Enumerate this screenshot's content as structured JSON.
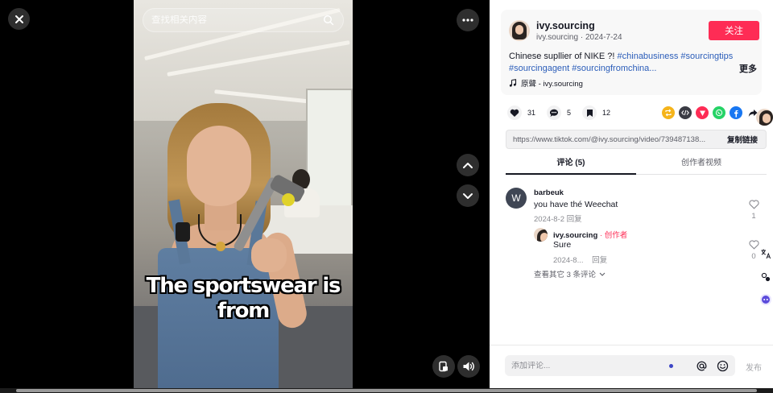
{
  "player": {
    "search": {
      "placeholder": "查找相关内容"
    },
    "caption_lines": [
      "The sportswear is",
      "from"
    ],
    "icons": {
      "close": "close-icon",
      "more": "more-icon",
      "prev": "chevron-up-icon",
      "next": "chevron-down-icon",
      "mini_player": "mini-player-icon",
      "volume": "volume-icon",
      "search": "search-icon"
    }
  },
  "author": {
    "name": "ivy.sourcing",
    "meta": "ivy.sourcing · 2024-7-24",
    "follow_label": "关注",
    "description_text": "Chinese supllier of NIKE ?! ",
    "hashtags": [
      "#chinabusiness",
      "#sourcingtips",
      "#sourcingagent",
      "#sourcingfromchina..."
    ],
    "more_label": "更多",
    "music": "原聲 - ivy.sourcing"
  },
  "actions": [
    {
      "icon": "heart-icon",
      "count": "31"
    },
    {
      "icon": "comment-icon",
      "count": "5"
    },
    {
      "icon": "bookmark-icon",
      "count": "12"
    }
  ],
  "share_icons": [
    "repost-icon",
    "embed-icon",
    "send-icon",
    "whatsapp-icon",
    "facebook-icon",
    "share-arrow-icon"
  ],
  "share_colors": {
    "repost": "#f5b41b",
    "embed": "#3a3b44",
    "send": "#fe2c55",
    "whatsapp": "#25d366",
    "facebook": "#1877f2"
  },
  "link": {
    "url": "https://www.tiktok.com/@ivy.sourcing/video/739487138...",
    "copy_label": "复制链接"
  },
  "tabs": [
    "评论 (5)",
    "创作者视频"
  ],
  "comments": [
    {
      "avatar_letter": "W",
      "user": "barbeuk",
      "text": "you have thé Weechat",
      "date": "2024-8-2",
      "reply_label": "回复",
      "likes": "1"
    }
  ],
  "reply": {
    "user": "ivy.sourcing",
    "creator_label": " · 创作者",
    "text": "Sure",
    "date": "2024-8...",
    "reply_label": "回复",
    "likes": "0"
  },
  "view_more": "查看其它 3 条评论",
  "comment_input": {
    "placeholder": "添加评论...",
    "post_label": "发布"
  },
  "accent_color": "#fe2c55"
}
